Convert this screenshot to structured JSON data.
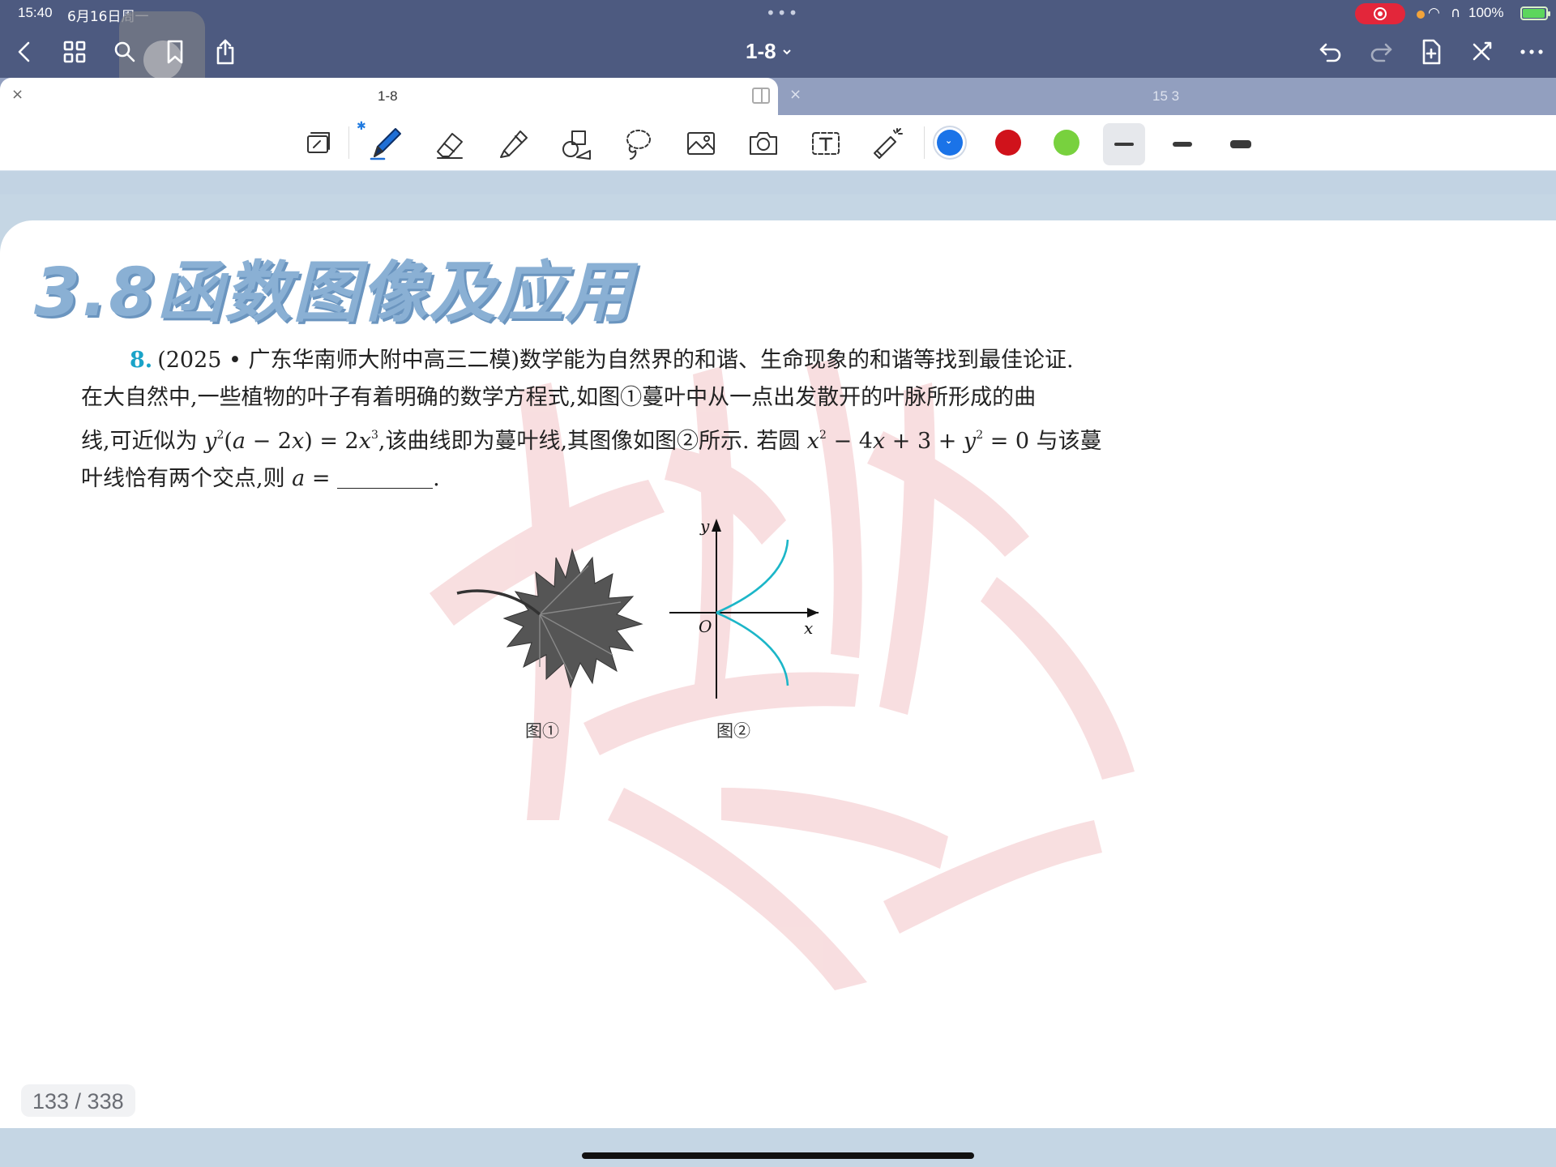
{
  "status": {
    "time": "15:40",
    "date": "6月16日周一",
    "battery": "100%",
    "icons": [
      "screen-record-icon",
      "wifi-icon",
      "headphone-icon",
      "battery-charging-icon"
    ]
  },
  "nav": {
    "title": "1-8",
    "icons": [
      "back-icon",
      "grid-icon",
      "search-icon",
      "bookmark-icon",
      "share-icon",
      "undo-icon",
      "redo-icon",
      "add-page-icon",
      "close-icon",
      "more-icon"
    ]
  },
  "tabs": [
    {
      "label": "1-8",
      "active": true
    },
    {
      "label": "15 3",
      "active": false
    }
  ],
  "toolbar": {
    "tools": [
      "page-mode",
      "pen",
      "eraser",
      "highlighter",
      "shapes",
      "lasso",
      "image",
      "camera",
      "text",
      "laser-pointer"
    ],
    "colors": [
      "#1a73e8",
      "#d0121b",
      "#78d13e"
    ],
    "selected_color": "#1a73e8",
    "thickness_selected": 0
  },
  "page": {
    "heading": "3.8函数图像及应用",
    "problem": {
      "number": "8.",
      "line1": "(2025 • 广东华南师大附中高三二模)数学能为自然界的和谐、生命现象的和谐等找到最佳论证.",
      "line2": "在大自然中,一些植物的叶子有着明确的数学方程式,如图①蔓叶中从一点出发散开的叶脉所形成的曲",
      "line3_a": "线,可近似为 ",
      "line3_b": ",该曲线即为蔓叶线,其图像如图②所示. 若圆 ",
      "line3_c": " 与该蔓",
      "line4_a": "叶线恰有两个交点,则 ",
      "line4_b": "."
    },
    "figure1_caption": "图①",
    "figure2_caption": "图②",
    "axis_x": "x",
    "axis_y": "y",
    "origin": "O"
  },
  "page_counter": "133 / 338"
}
